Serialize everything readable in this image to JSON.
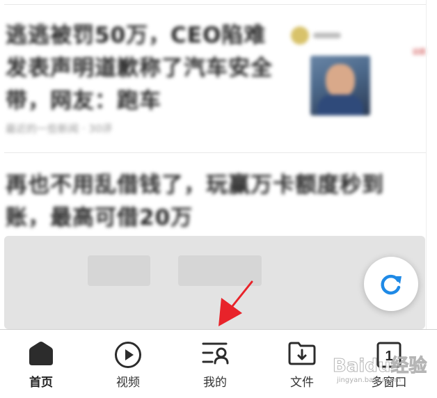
{
  "feed": {
    "article1": {
      "title": "逃逃被罚50万，CEO陷难发表声明道歉称了汽车安全带，网友：跑车",
      "meta": "最近的一些新闻 · 30评",
      "side_tag": "话题"
    },
    "article2": {
      "title": "再也不用乱借钱了，玩赢万卡额度秒到账，最高可借20万"
    }
  },
  "refresh": {
    "icon": "refresh-icon",
    "color": "#1f8ae6"
  },
  "tabbar": {
    "tabs": [
      {
        "id": "home",
        "label": "首页",
        "icon": "home-icon"
      },
      {
        "id": "video",
        "label": "视频",
        "icon": "play-circle-icon"
      },
      {
        "id": "mine",
        "label": "我的",
        "icon": "profile-list-icon"
      },
      {
        "id": "files",
        "label": "文件",
        "icon": "folder-download-icon"
      },
      {
        "id": "windows",
        "label": "多窗口",
        "icon": "window-count-icon",
        "badge": "1"
      }
    ]
  },
  "watermark": {
    "text": "Baidu经验",
    "sub": "jingyan.baidu.com"
  },
  "annotation": {
    "arrow_color": "#e8232a"
  }
}
